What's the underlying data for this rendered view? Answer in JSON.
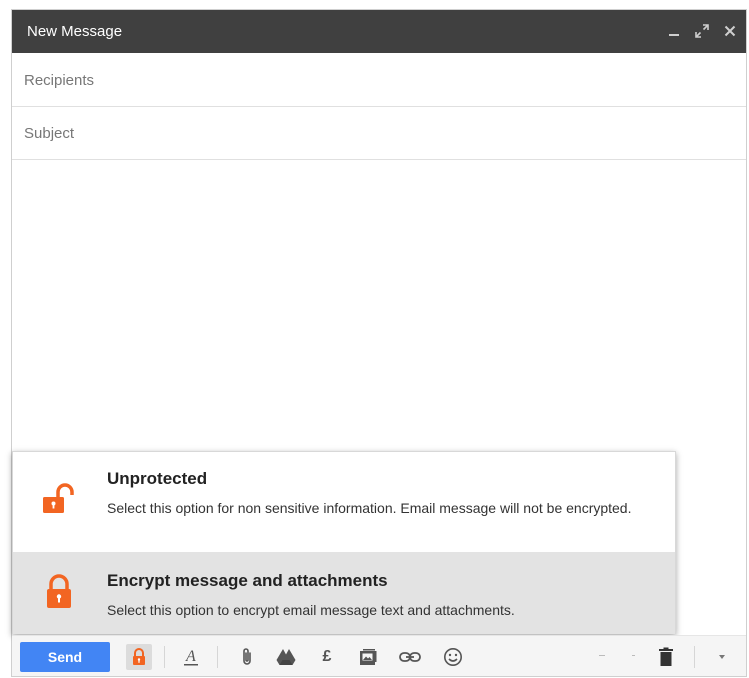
{
  "window": {
    "title": "New Message",
    "controls": [
      "minimize-icon",
      "expand-icon",
      "close-icon"
    ]
  },
  "fields": {
    "recipients_placeholder": "Recipients",
    "subject_placeholder": "Subject"
  },
  "encryption_menu": {
    "options": [
      {
        "title": "Unprotected",
        "description": "Select this option for non sensitive information. Email message will not be encrypted.",
        "icon": "unlocked-padlock-icon",
        "selected": false
      },
      {
        "title": "Encrypt message and attachments",
        "description": "Select this option to encrypt email message text and attachments.",
        "icon": "locked-padlock-icon",
        "selected": true
      }
    ]
  },
  "toolbar": {
    "send_label": "Send",
    "currency_symbol": "£",
    "icons": [
      "encrypt-lock-icon",
      "text-format-icon",
      "attach-icon",
      "drive-icon",
      "currency-icon",
      "photo-icon",
      "link-icon",
      "emoji-icon",
      "trash-icon",
      "more-options-icon"
    ]
  },
  "colors": {
    "title_bar": "#404040",
    "accent_orange": "#f26522",
    "send_button": "#4285f4",
    "selected_row": "#e3e3e3"
  }
}
